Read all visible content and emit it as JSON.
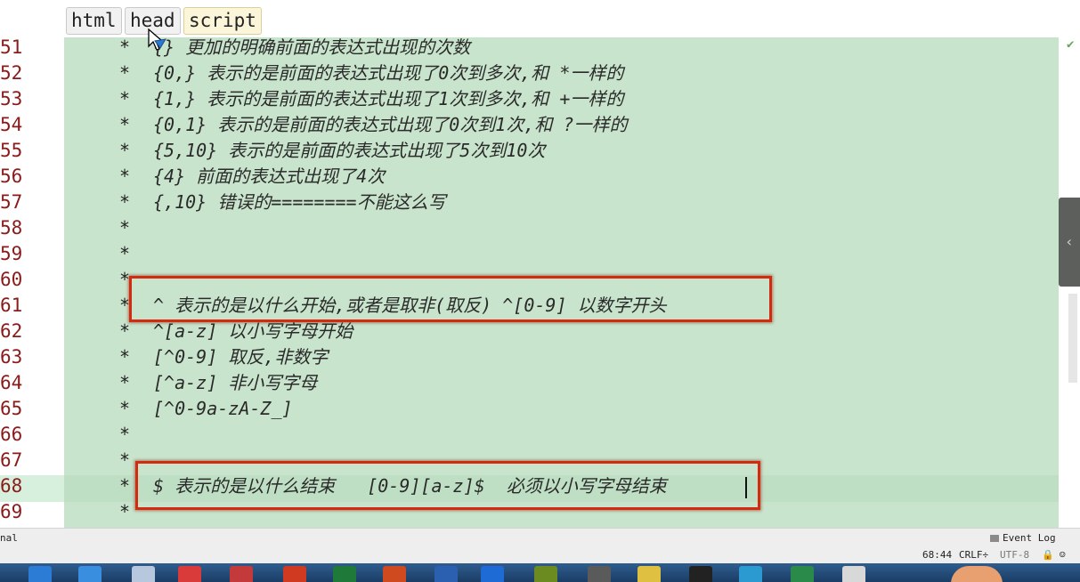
{
  "breadcrumbs": [
    "html",
    "head",
    "script"
  ],
  "lines": [
    {
      "no": "51",
      "star": "*",
      "text": "{} 更加的明确前面的表达式出现的次数"
    },
    {
      "no": "52",
      "star": "*",
      "text": "{0,} 表示的是前面的表达式出现了0次到多次,和 *一样的"
    },
    {
      "no": "53",
      "star": "*",
      "text": "{1,} 表示的是前面的表达式出现了1次到多次,和 +一样的"
    },
    {
      "no": "54",
      "star": "*",
      "text": "{0,1} 表示的是前面的表达式出现了0次到1次,和 ?一样的"
    },
    {
      "no": "55",
      "star": "*",
      "text": "{5,10} 表示的是前面的表达式出现了5次到10次"
    },
    {
      "no": "56",
      "star": "*",
      "text": "{4} 前面的表达式出现了4次"
    },
    {
      "no": "57",
      "star": "*",
      "text": "{,10} 错误的========不能这么写"
    },
    {
      "no": "58",
      "star": "*",
      "text": ""
    },
    {
      "no": "59",
      "star": "*",
      "text": ""
    },
    {
      "no": "60",
      "star": "*",
      "text": ""
    },
    {
      "no": "61",
      "star": "*",
      "text": "^ 表示的是以什么开始,或者是取非(取反) ^[0-9] 以数字开头"
    },
    {
      "no": "62",
      "star": "*",
      "text": "^[a-z] 以小写字母开始"
    },
    {
      "no": "63",
      "star": "*",
      "text": "[^0-9] 取反,非数字"
    },
    {
      "no": "64",
      "star": "*",
      "text": "[^a-z] 非小写字母"
    },
    {
      "no": "65",
      "star": "*",
      "text": "[^0-9a-zA-Z_]"
    },
    {
      "no": "66",
      "star": "*",
      "text": ""
    },
    {
      "no": "67",
      "star": "*",
      "text": ""
    },
    {
      "no": "68",
      "star": "*",
      "text": "$ 表示的是以什么结束   [0-9][a-z]$  必须以小写字母结束"
    },
    {
      "no": "69",
      "star": "*",
      "text": ""
    }
  ],
  "status": {
    "left": "nal",
    "event_log": "Event Log",
    "position": "68:44",
    "line_sep": "CRLF÷",
    "encoding": "UTF-8"
  },
  "colors": {
    "editor_bg": "#c8e4cc",
    "line_number": "#8b1a1a",
    "highlight_box": "#d22b12"
  }
}
